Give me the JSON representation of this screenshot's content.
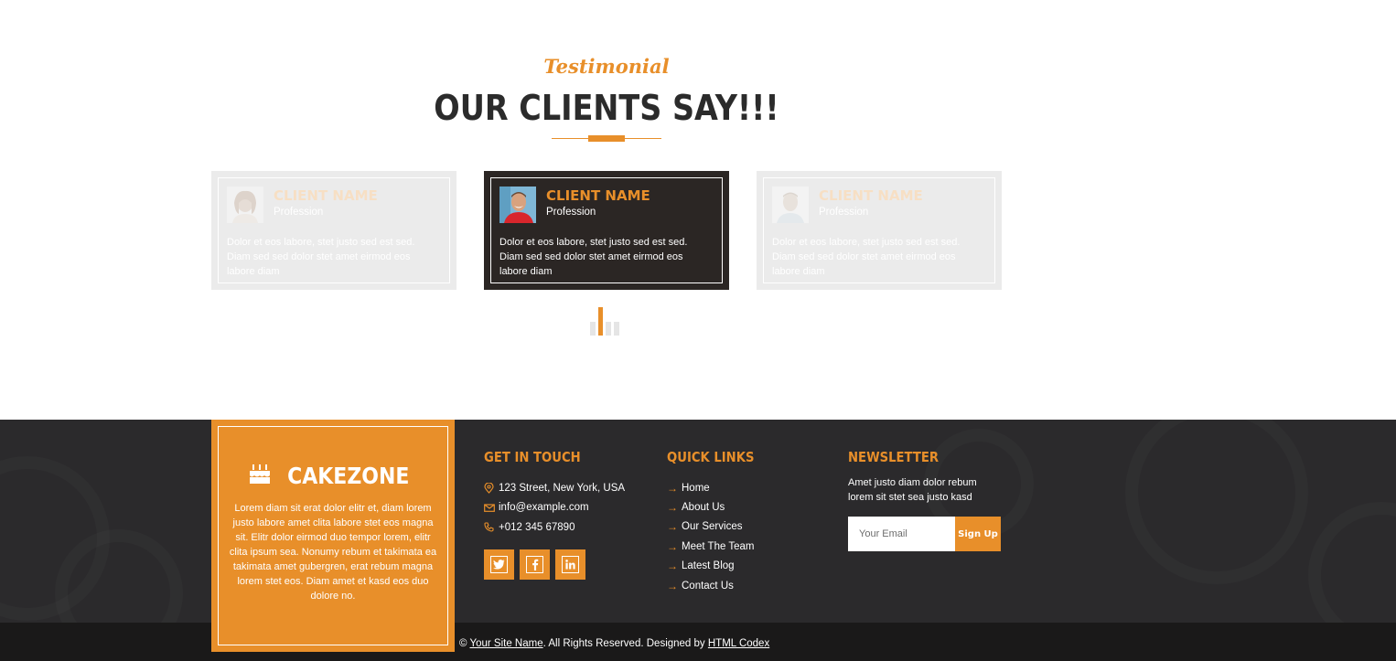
{
  "section": {
    "subtitle": "Testimonial",
    "title": "OUR CLIENTS SAY!!!"
  },
  "testimonials": [
    {
      "name": "CLIENT NAME",
      "profession": "Profession",
      "text": "Dolor et eos labore, stet justo sed est sed. Diam sed sed dolor stet amet eirmod eos labore diam",
      "state": "faded"
    },
    {
      "name": "CLIENT NAME",
      "profession": "Profession",
      "text": "Dolor et eos labore, stet justo sed est sed. Diam sed sed dolor stet amet eirmod eos labore diam",
      "state": "active"
    },
    {
      "name": "CLIENT NAME",
      "profession": "Profession",
      "text": "Dolor et eos labore, stet justo sed est sed. Diam sed sed dolor stet amet eirmod eos labore diam",
      "state": "faded"
    }
  ],
  "carousel": {
    "dot_count": 4,
    "active_index": 1
  },
  "footer": {
    "brand": {
      "name": "CAKEZONE",
      "icon": "birthday-cake-icon",
      "description": "Lorem diam sit erat dolor elitr et, diam lorem justo labore amet clita labore stet eos magna sit. Elitr dolor eirmod duo tempor lorem, elitr clita ipsum sea. Nonumy rebum et takimata ea takimata amet gubergren, erat rebum magna lorem stet eos. Diam amet et kasd eos duo dolore no."
    },
    "contact": {
      "heading": "GET IN TOUCH",
      "address": "123 Street, New York, USA",
      "email": "info@example.com",
      "phone": "+012 345 67890",
      "social": [
        "twitter-icon",
        "facebook-icon",
        "linkedin-icon"
      ]
    },
    "quick_links": {
      "heading": "QUICK LINKS",
      "items": [
        "Home",
        "About Us",
        "Our Services",
        "Meet The Team",
        "Latest Blog",
        "Contact Us"
      ]
    },
    "newsletter": {
      "heading": "NEWSLETTER",
      "text": "Amet justo diam dolor rebum lorem sit stet sea justo kasd",
      "placeholder": "Your Email",
      "button": "Sign Up"
    },
    "copyright": {
      "prefix": "©",
      "site_name": "Your Site Name",
      "middle": ". All Rights Reserved. Designed by",
      "designer": "HTML Codex"
    }
  },
  "colors": {
    "accent": "#E88F2A",
    "dark": "#2B2A2C",
    "darker": "#1A1919"
  }
}
